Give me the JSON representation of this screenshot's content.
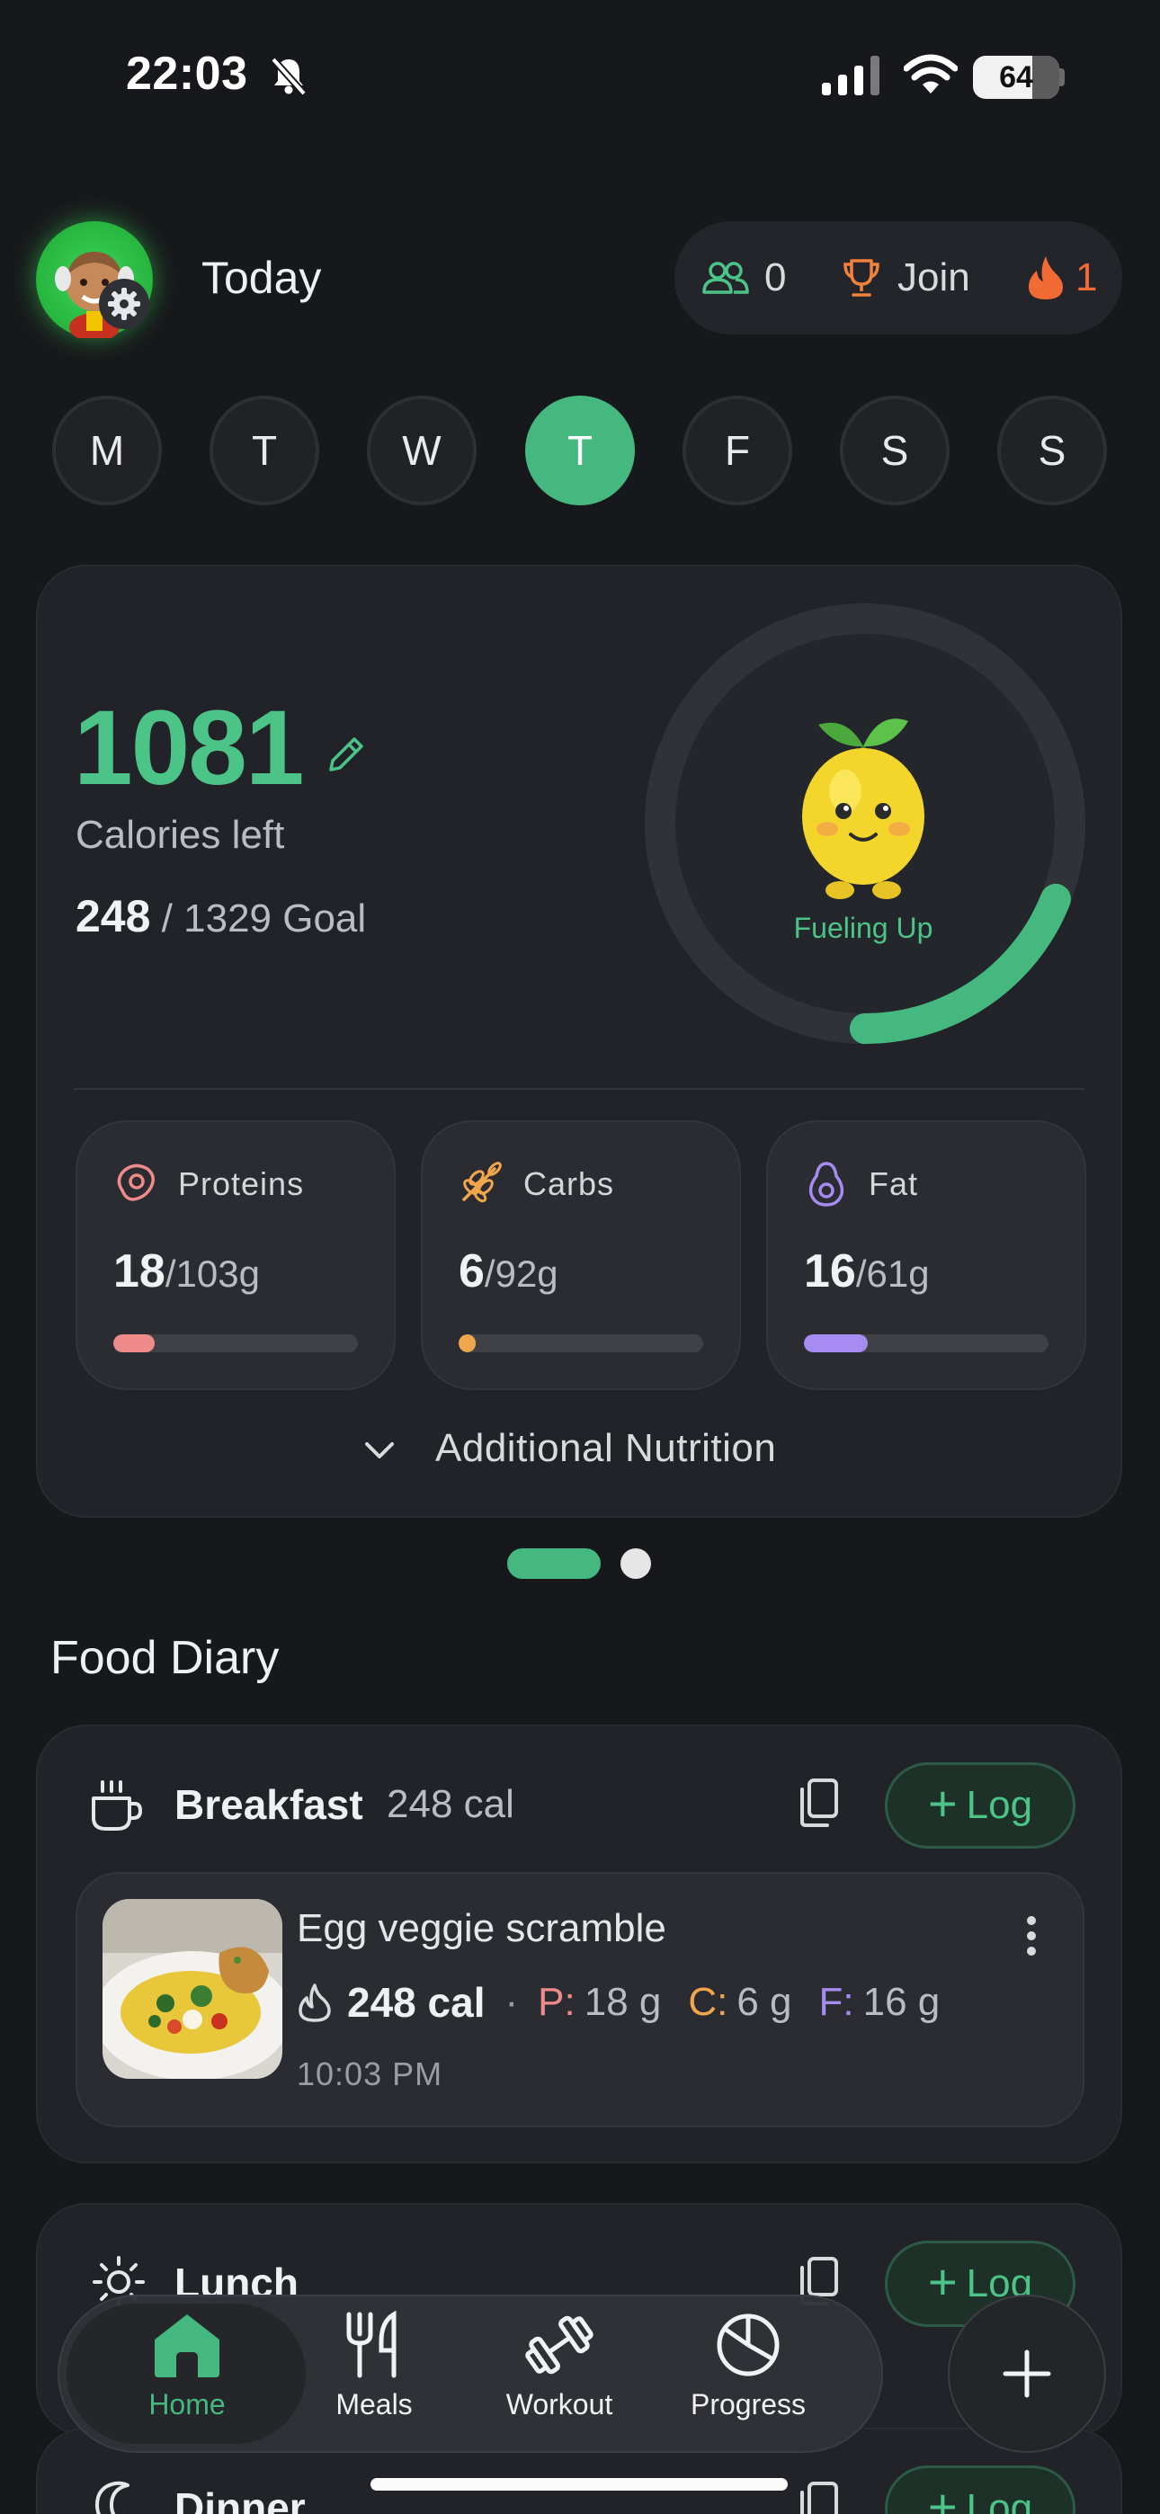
{
  "status_bar": {
    "time": "22:03",
    "battery": "64"
  },
  "header": {
    "title": "Today",
    "friends_count": "0",
    "join_label": "Join",
    "streak": "1"
  },
  "week": {
    "days": [
      "M",
      "T",
      "W",
      "T",
      "F",
      "S",
      "S"
    ],
    "active_index": 3
  },
  "summary": {
    "calories_left": "1081",
    "calories_left_label": "Calories left",
    "consumed": "248",
    "goal_text": "/ 1329 Goal",
    "mascot_status": "Fueling Up",
    "progress_fraction": 0.19,
    "macros": [
      {
        "name": "Proteins",
        "value": "18",
        "goal": "/103g",
        "fraction": 0.17,
        "color": "#f08b8b"
      },
      {
        "name": "Carbs",
        "value": "6",
        "goal": "/92g",
        "fraction": 0.07,
        "color": "#f0a64a"
      },
      {
        "name": "Fat",
        "value": "16",
        "goal": "/61g",
        "fraction": 0.26,
        "color": "#a68bf0"
      }
    ],
    "additional_label": "Additional Nutrition"
  },
  "diary": {
    "title": "Food Diary",
    "log_label": "Log",
    "breakfast": {
      "name": "Breakfast",
      "calories": "248 cal",
      "entry": {
        "name": "Egg veggie scramble",
        "calories": "248 cal",
        "protein": "18 g",
        "carbs": "6 g",
        "fat": "16 g",
        "time": "10:03 PM"
      }
    },
    "lunch": {
      "name": "Lunch"
    },
    "dinner": {
      "name": "Dinner"
    }
  },
  "macro_letters": {
    "protein": "P:",
    "carbs": "C:",
    "fat": "F:"
  },
  "nav": {
    "items": [
      "Home",
      "Meals",
      "Workout",
      "Progress"
    ],
    "active": "Home"
  },
  "colors": {
    "accent": "#45b880",
    "streak": "#f26b35",
    "trophy": "#f0823a"
  }
}
